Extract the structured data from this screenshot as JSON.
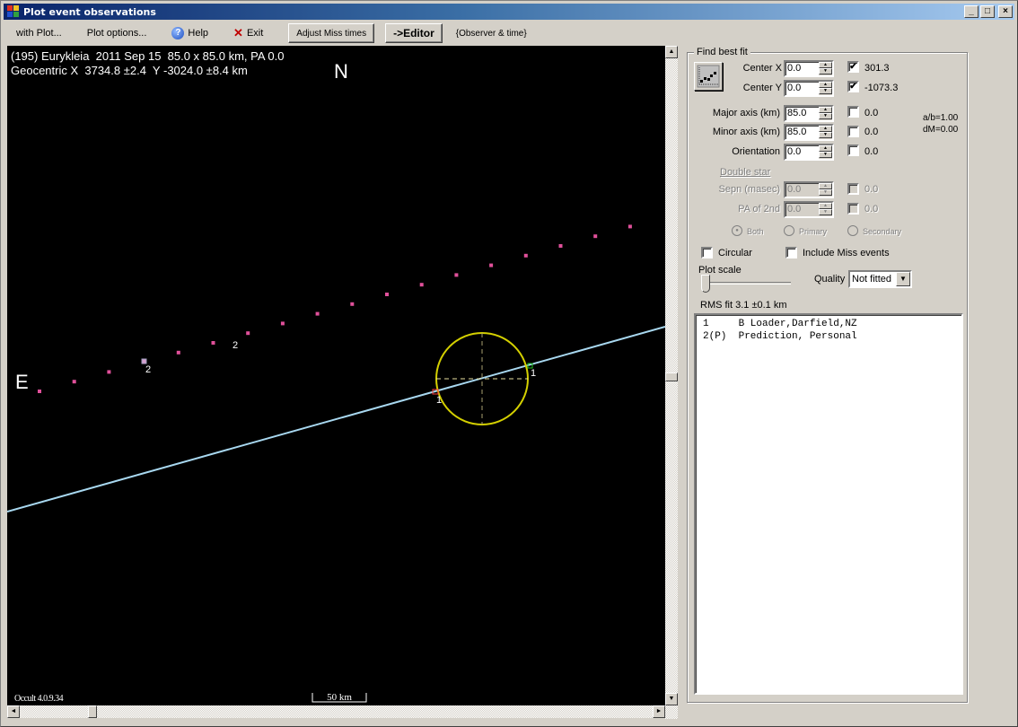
{
  "window": {
    "title": "Plot event observations",
    "controls": {
      "minimize": "_",
      "maximize": "□",
      "close": "×"
    }
  },
  "toolbar": {
    "with_plot": "with Plot...",
    "plot_options": "Plot options...",
    "help": "Help",
    "exit": "Exit",
    "adjust_miss_times": "Adjust Miss times",
    "editor": "->Editor",
    "observer_time": "{Observer & time}"
  },
  "plot": {
    "header_line1": "(195) Eurykleia  2011 Sep 15  85.0 x 85.0 km, PA 0.0",
    "header_line2": "Geocentric X  3734.8 ±2.4  Y -3024.0 ±8.4 km",
    "north_label": "N",
    "east_label": "E",
    "version": "Occult 4.0.9.34",
    "scale_label": "50 km",
    "chord_labels": {
      "observer_1_label": "1",
      "prediction_label": "2"
    },
    "colors": {
      "background": "#000000",
      "ellipse": "#d4d000",
      "chord": "#a8d8f0",
      "prediction_dots": "#e0509a",
      "disappear_marker": "#ff4040",
      "reappear_marker": "#20c020"
    }
  },
  "fit_panel": {
    "title": "Find best fit",
    "center_x": {
      "label": "Center X",
      "value": "0.0",
      "checked": true,
      "fit": "301.3"
    },
    "center_y": {
      "label": "Center Y",
      "value": "0.0",
      "checked": true,
      "fit": "-1073.3"
    },
    "major_axis": {
      "label": "Major axis (km)",
      "value": "85.0",
      "checked": false,
      "fit": "0.0"
    },
    "minor_axis": {
      "label": "Minor axis (km)",
      "value": "85.0",
      "checked": false,
      "fit": "0.0"
    },
    "orientation": {
      "label": "Orientation",
      "value": "0.0",
      "checked": false,
      "fit": "0.0"
    },
    "ab_ratio": "a/b=1.00",
    "dm": "dM=0.00",
    "double_star": {
      "title": "Double star",
      "sepn": {
        "label": "Sepn (masec)",
        "value": "0.0",
        "checked": false,
        "fit": "0.0"
      },
      "pa_2nd": {
        "label": "PA of 2nd",
        "value": "0.0",
        "checked": false,
        "fit": "0.0"
      },
      "radios": [
        {
          "label": "Both",
          "selected": true
        },
        {
          "label": "Primary",
          "selected": false
        },
        {
          "label": "Secondary",
          "selected": false
        }
      ]
    },
    "circular": {
      "label": "Circular",
      "checked": false
    },
    "include_miss": {
      "label": "Include Miss events",
      "checked": false
    },
    "plot_scale_label": "Plot scale",
    "plot_scale_value_fraction": 0.0,
    "quality_label": "Quality",
    "quality_value": "Not fitted",
    "rms_fit": "RMS fit 3.1 ±0.1 km",
    "observers": [
      {
        "text": "1     B Loader,Darfield,NZ"
      },
      {
        "text": "2(P)  Prediction, Personal"
      }
    ]
  }
}
